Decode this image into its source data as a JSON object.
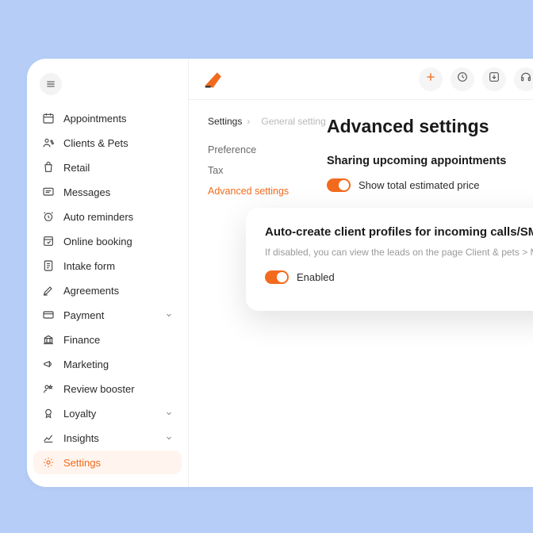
{
  "sidebar": {
    "items": [
      {
        "label": "Appointments",
        "icon": "calendar-icon",
        "expandable": false
      },
      {
        "label": "Clients & Pets",
        "icon": "clients-icon",
        "expandable": false
      },
      {
        "label": "Retail",
        "icon": "retail-icon",
        "expandable": false
      },
      {
        "label": "Messages",
        "icon": "messages-icon",
        "expandable": false
      },
      {
        "label": "Auto reminders",
        "icon": "clock-alert-icon",
        "expandable": false
      },
      {
        "label": "Online booking",
        "icon": "booking-icon",
        "expandable": false
      },
      {
        "label": "Intake form",
        "icon": "form-icon",
        "expandable": false
      },
      {
        "label": "Agreements",
        "icon": "pen-icon",
        "expandable": false
      },
      {
        "label": "Payment",
        "icon": "payment-icon",
        "expandable": true
      },
      {
        "label": "Finance",
        "icon": "bank-icon",
        "expandable": false
      },
      {
        "label": "Marketing",
        "icon": "megaphone-icon",
        "expandable": false
      },
      {
        "label": "Review booster",
        "icon": "review-icon",
        "expandable": false
      },
      {
        "label": "Loyalty",
        "icon": "loyalty-icon",
        "expandable": true
      },
      {
        "label": "Insights",
        "icon": "chart-icon",
        "expandable": true
      },
      {
        "label": "Settings",
        "icon": "gear-icon",
        "expandable": false,
        "active": true
      }
    ]
  },
  "topbar": {
    "buttons": [
      {
        "name": "add-button",
        "icon": "plus-icon"
      },
      {
        "name": "history-button",
        "icon": "clock-icon"
      },
      {
        "name": "download-button",
        "icon": "download-icon"
      },
      {
        "name": "support-button",
        "icon": "headset-icon"
      }
    ]
  },
  "breadcrumb": {
    "root": "Settings",
    "current": "General setting"
  },
  "subnav": {
    "items": [
      {
        "label": "Preference"
      },
      {
        "label": "Tax"
      },
      {
        "label": "Advanced settings",
        "active": true
      }
    ]
  },
  "page": {
    "title": "Advanced settings",
    "section1_title": "Sharing upcoming appointments",
    "toggle1_label": "Show total estimated price"
  },
  "card": {
    "title": "Auto-create client profiles for incoming calls/SMS",
    "desc": "If disabled, you can view the leads on the page Client & pets > More options",
    "toggle_label": "Enabled"
  },
  "colors": {
    "accent": "#f26b1d"
  }
}
